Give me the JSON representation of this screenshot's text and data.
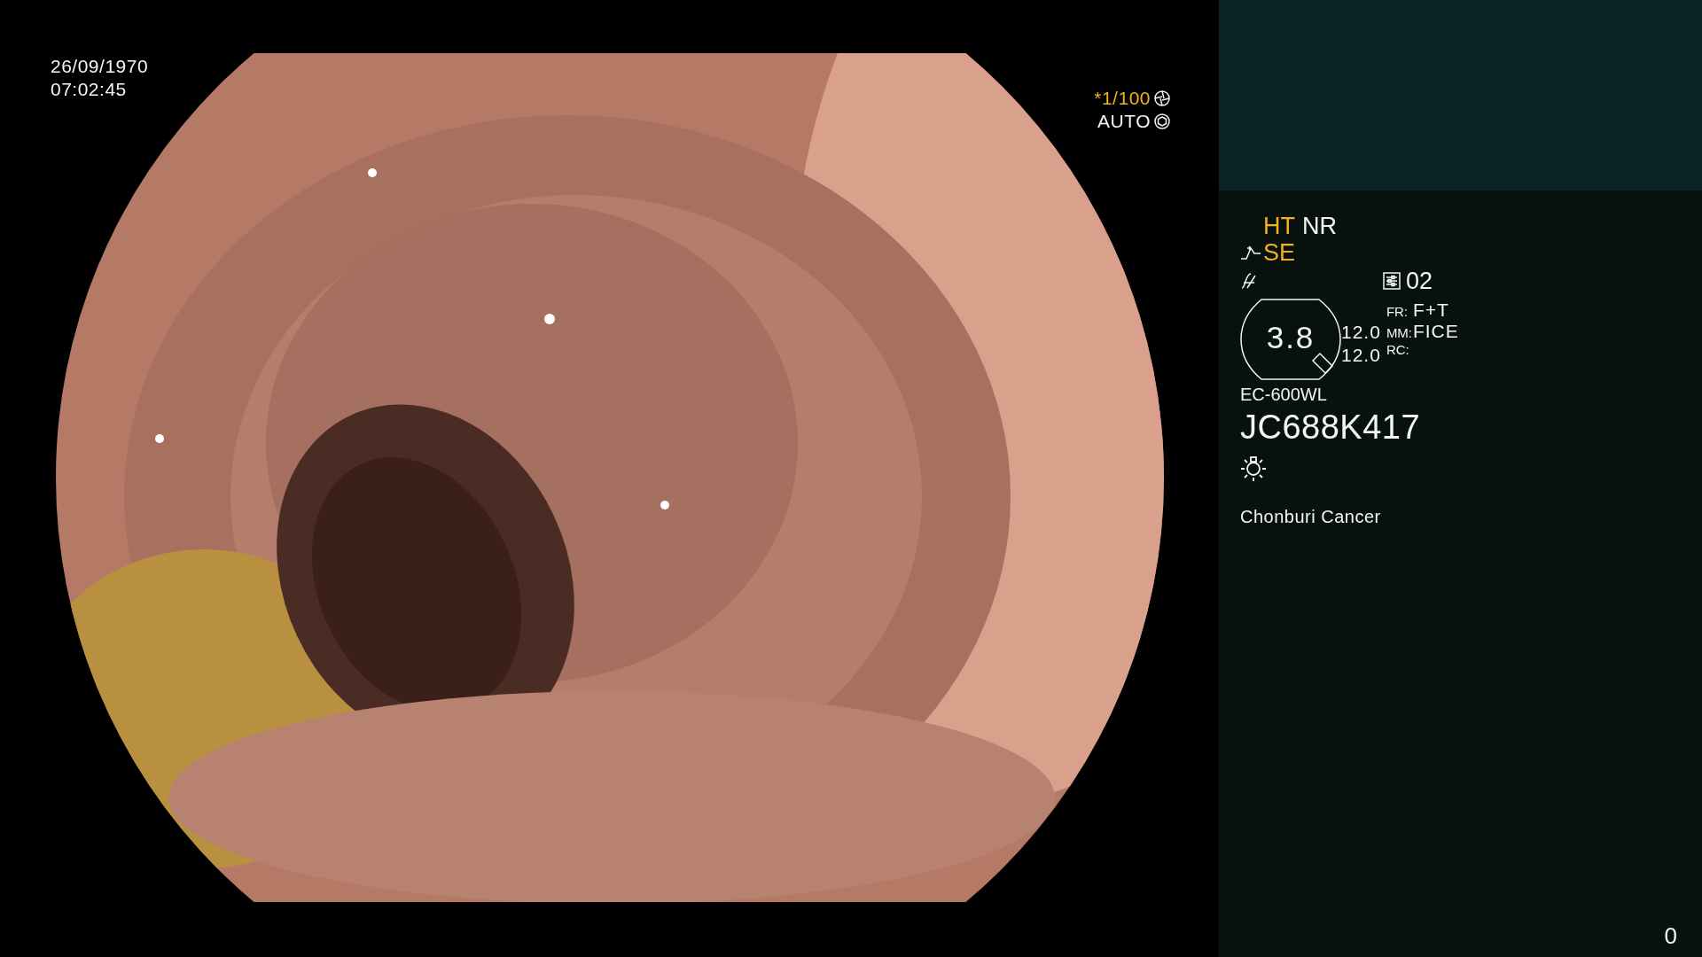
{
  "capture": {
    "date": "26/09/1970",
    "time": "07:02:45",
    "shutter": "*1/100",
    "iris": "AUTO"
  },
  "panel": {
    "modes": [
      {
        "label": "HT",
        "on": true
      },
      {
        "label": "NR",
        "on": false
      }
    ],
    "enhance": {
      "label": "SE",
      "on": true
    },
    "preset": "02",
    "zoom": "3.8",
    "readings": [
      "12.0",
      "12.0"
    ],
    "settings": [
      {
        "label": "FR:",
        "value": "F+T"
      },
      {
        "label": "MM:",
        "value": "FICE"
      },
      {
        "label": "RC:"
      }
    ],
    "scope_model": "EC-600WL",
    "serial": "JC688K417",
    "institution": "Chonburi Cancer"
  },
  "counter": "0"
}
